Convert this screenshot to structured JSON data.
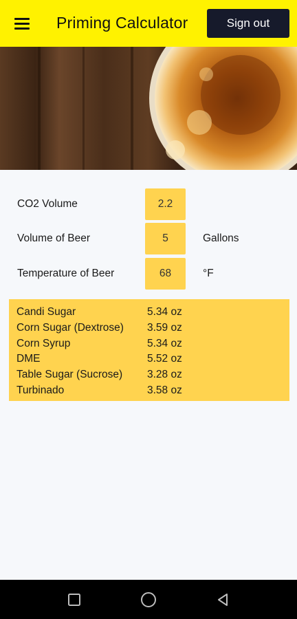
{
  "app": {
    "title": "Priming Calculator"
  },
  "header": {
    "sign_out_label": "Sign out"
  },
  "form": {
    "co2_label": "CO2 Volume",
    "co2_value": "2.2",
    "volume_label": "Volume of Beer",
    "volume_value": "5",
    "volume_unit": "Gallons",
    "temp_label": "Temperature of Beer",
    "temp_value": "68",
    "temp_unit": "°F"
  },
  "results": [
    {
      "name": "Candi Sugar",
      "value": "5.34 oz"
    },
    {
      "name": "Corn Sugar (Dextrose)",
      "value": "3.59 oz"
    },
    {
      "name": "Corn Syrup",
      "value": "5.34 oz"
    },
    {
      "name": "DME",
      "value": "5.52 oz"
    },
    {
      "name": "Table Sugar (Sucrose)",
      "value": "3.28 oz"
    },
    {
      "name": "Turbinado",
      "value": "3.58 oz"
    }
  ],
  "colors": {
    "appbar": "#fff200",
    "accent_box": "#ffd34f",
    "sign_out_button": "#161a2b"
  },
  "icons": {
    "menu": "hamburger-icon",
    "nav_recents": "square-icon",
    "nav_home": "circle-icon",
    "nav_back": "triangle-back-icon"
  }
}
